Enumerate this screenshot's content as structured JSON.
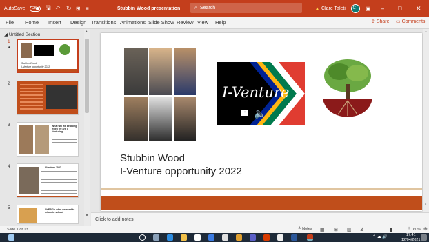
{
  "titlebar": {
    "autosave": "AutoSave",
    "toggle": "Off",
    "doc_title": "Stubbin Wood presentation",
    "search_placeholder": "Search",
    "user": "Clare Taleti",
    "initials": "CT",
    "minimize": "–",
    "maximize": "□",
    "close": "✕"
  },
  "menu": [
    "File",
    "Home",
    "Insert",
    "Design",
    "Transitions",
    "Animations",
    "Slide Show",
    "Review",
    "View",
    "Help"
  ],
  "share": "Share",
  "comments": "Comments",
  "thumbs": {
    "section": "Untitled Section",
    "nums": [
      "1",
      "2",
      "3",
      "4",
      "5"
    ],
    "s1_title": "Stubbin Wood",
    "s1_sub": "I-Venture opportunity 2022",
    "s3_title": "What will we be doing when we are I-Venturing...",
    "s4_title": "I-Venture 2022",
    "s5_title": "SHEBO's what we need to return to school"
  },
  "slide": {
    "logo_text": "I-Venture",
    "title_line1": "Stubbin Wood",
    "title_line2": "I-Venture opportunity 2022"
  },
  "notes": "Click to add notes",
  "status": {
    "slide_count": "Slide 1 of 13",
    "notes_btn": "Notes",
    "zoom": "60%"
  },
  "taskbar": {
    "time": "17:41",
    "date": "12/04/2021"
  },
  "colors": {
    "accent": "#c43e1c",
    "band": "#c04e1b"
  }
}
